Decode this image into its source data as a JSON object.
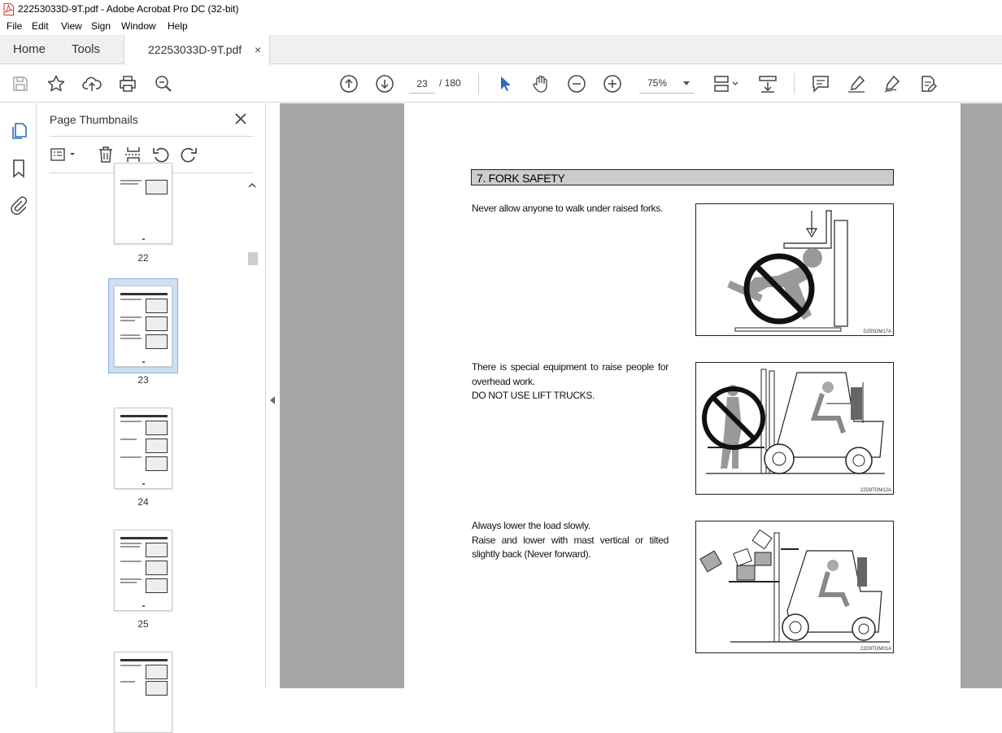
{
  "window": {
    "title": "22253033D-9T.pdf - Adobe Acrobat Pro DC (32-bit)"
  },
  "menu": [
    "File",
    "Edit",
    "View",
    "Sign",
    "Window",
    "Help"
  ],
  "tabs": {
    "home": "Home",
    "tools": "Tools",
    "document": "22253033D-9T.pdf",
    "close": "×"
  },
  "toolbar": {
    "current_page": "23",
    "page_count": "/ 180",
    "zoom": "75%",
    "icons": [
      "save-icon",
      "star-icon",
      "upload-icon",
      "print-icon",
      "search-zoom-icon",
      "page-up-icon",
      "page-down-icon",
      "select-cursor-icon",
      "hand-icon",
      "zoom-out-icon",
      "zoom-in-icon",
      "page-display-icon",
      "scroll-mode-icon",
      "comment-icon",
      "highlight-icon",
      "sign-icon",
      "edit-pdf-icon"
    ]
  },
  "sidebar": {
    "panel_title": "Page Thumbnails",
    "thumbnails": [
      {
        "label": "22",
        "selected": false
      },
      {
        "label": "23",
        "selected": true
      },
      {
        "label": "24",
        "selected": false
      },
      {
        "label": "25",
        "selected": false
      }
    ]
  },
  "document": {
    "section_title": "7. FORK SAFETY",
    "blocks": [
      {
        "lines": [
          "Never allow anyone to walk under raised forks."
        ],
        "figure_code": "D255OM17A"
      },
      {
        "lines": [
          "There is special equipment to raise people for",
          "overhead work.",
          "DO NOT USE LIFT TRUCKS."
        ],
        "figure_code": "22D9TOM12A"
      },
      {
        "lines": [
          "Always lower the load slowly.",
          "Raise and lower with mast vertical or tilted",
          "slightly back (Never forward)."
        ],
        "figure_code": "22D9TOM01A"
      }
    ]
  },
  "colors": {
    "selected_thumb": "#cfe0f2",
    "viewport_bg": "#a6a6a6",
    "accent_blue": "#2a6ebb",
    "pdf_red": "#d9302c"
  }
}
